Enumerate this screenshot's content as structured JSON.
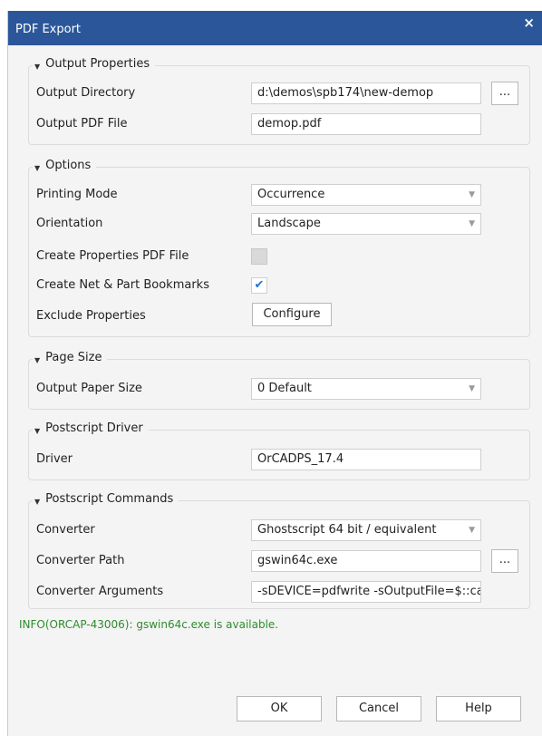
{
  "dialog": {
    "title": "PDF Export",
    "close_glyph": "×"
  },
  "output_properties": {
    "legend": "Output Properties",
    "output_directory_label": "Output Directory",
    "output_directory_value": "d:\\demos\\spb174\\new-demop",
    "browse_label": "...",
    "output_pdf_label": "Output PDF File",
    "output_pdf_value": "demop.pdf"
  },
  "options": {
    "legend": "Options",
    "printing_mode_label": "Printing Mode",
    "printing_mode_value": "Occurrence",
    "orientation_label": "Orientation",
    "orientation_value": "Landscape",
    "create_props_label": "Create Properties PDF File",
    "create_props_checked": false,
    "create_bookmarks_label": "Create Net & Part Bookmarks",
    "create_bookmarks_checked": true,
    "check_glyph": "✔",
    "exclude_label": "Exclude Properties",
    "configure_label": "Configure"
  },
  "page_size": {
    "legend": "Page Size",
    "paper_label": "Output Paper Size",
    "paper_value": "0 Default"
  },
  "postscript_driver": {
    "legend": "Postscript Driver",
    "driver_label": "Driver",
    "driver_value": "OrCADPS_17.4"
  },
  "postscript_commands": {
    "legend": "Postscript Commands",
    "converter_label": "Converter",
    "converter_value": "Ghostscript 64 bit / equivalent",
    "converter_path_label": "Converter Path",
    "converter_path_value": "gswin64c.exe",
    "browse_label": "...",
    "converter_args_label": "Converter Arguments",
    "converter_args_value": "-sDEVICE=pdfwrite -sOutputFile=$::ca"
  },
  "info_message": "INFO(ORCAP-43006): gswin64c.exe is available.",
  "buttons": {
    "ok": "OK",
    "cancel": "Cancel",
    "help": "Help"
  },
  "icons": {
    "caret": "caret-down-icon",
    "dropdown": "chevron-down-icon"
  },
  "colors": {
    "titlebar": "#2b579a",
    "info_text": "#2e8b2e",
    "check": "#1a73d9"
  }
}
